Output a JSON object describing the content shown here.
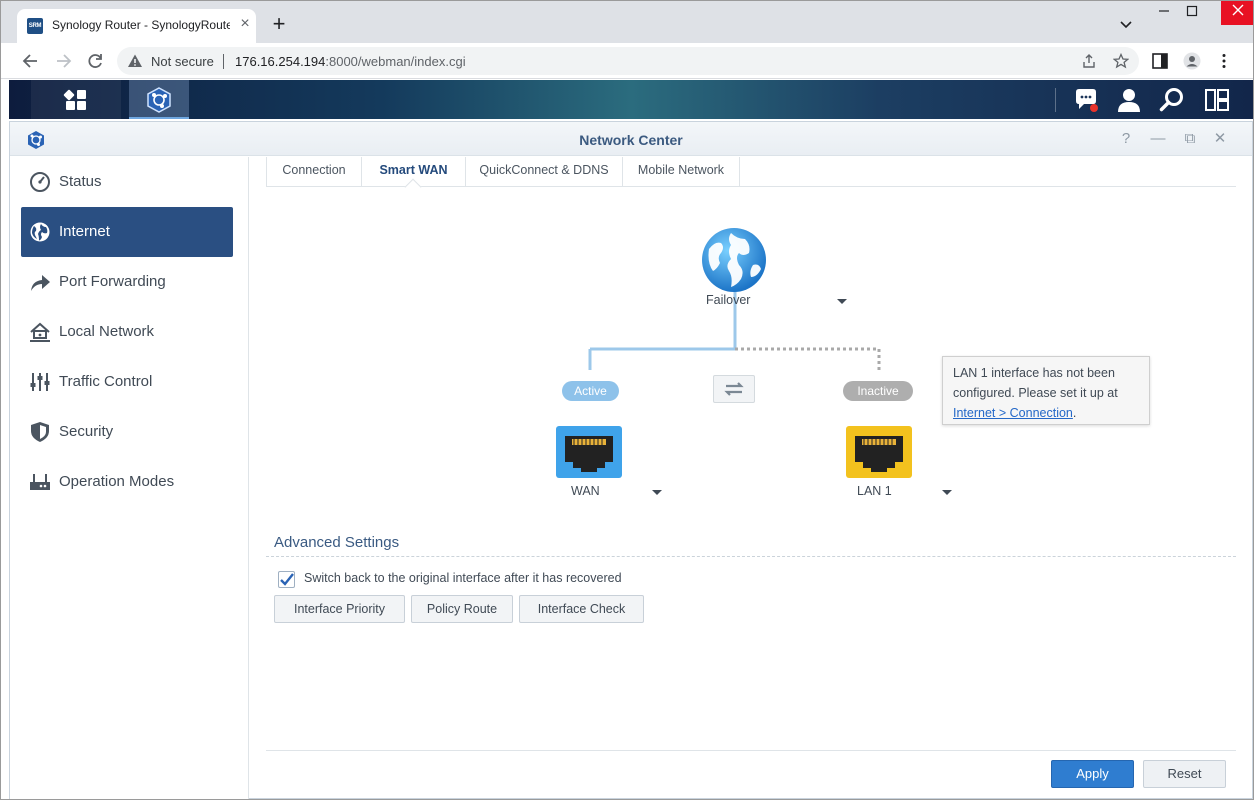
{
  "browser": {
    "tab_title": "Synology Router - SynologyRouter",
    "favicon_text": "SRM",
    "close_tab_glyph": "×",
    "new_tab_glyph": "+",
    "security_label": "Not secure",
    "url_host": "176.16.254.194",
    "url_rest": ":8000/webman/index.cgi"
  },
  "window": {
    "title": "Network Center",
    "help_glyph": "?",
    "minimize_glyph": "—",
    "restore_glyph": "⧉",
    "close_glyph": "✕"
  },
  "sidebar": {
    "items": [
      {
        "label": "Status",
        "icon": "gauge-icon",
        "active": false
      },
      {
        "label": "Internet",
        "icon": "globe-icon",
        "active": true
      },
      {
        "label": "Port Forwarding",
        "icon": "forward-arrow-icon",
        "active": false
      },
      {
        "label": "Local Network",
        "icon": "home-network-icon",
        "active": false
      },
      {
        "label": "Traffic Control",
        "icon": "sliders-icon",
        "active": false
      },
      {
        "label": "Security",
        "icon": "shield-icon",
        "active": false
      },
      {
        "label": "Operation Modes",
        "icon": "router-icon",
        "active": false
      }
    ]
  },
  "tabs": [
    {
      "label": "Connection",
      "active": false
    },
    {
      "label": "Smart WAN",
      "active": true
    },
    {
      "label": "QuickConnect & DDNS",
      "active": false
    },
    {
      "label": "Mobile Network",
      "active": false
    }
  ],
  "diagram": {
    "mode_label": "Failover",
    "active_pill": "Active",
    "inactive_pill": "Inactive",
    "wan_label": "WAN",
    "lan_label": "LAN 1",
    "tooltip_text": "LAN 1 interface has not been configured. Please set it up at",
    "tooltip_link": "Internet > Connection",
    "tooltip_end": ".",
    "colors": {
      "active": "#8ec2ea",
      "inactive": "#aeaeae",
      "wan_port": "#3fa3ea",
      "lan_port": "#f3c21e"
    }
  },
  "advanced": {
    "title": "Advanced Settings",
    "checkbox_label": "Switch back to the original interface after it has recovered",
    "checkbox_checked": true,
    "buttons": [
      "Interface Priority",
      "Policy Route",
      "Interface Check"
    ]
  },
  "footer": {
    "apply_label": "Apply",
    "reset_label": "Reset"
  }
}
